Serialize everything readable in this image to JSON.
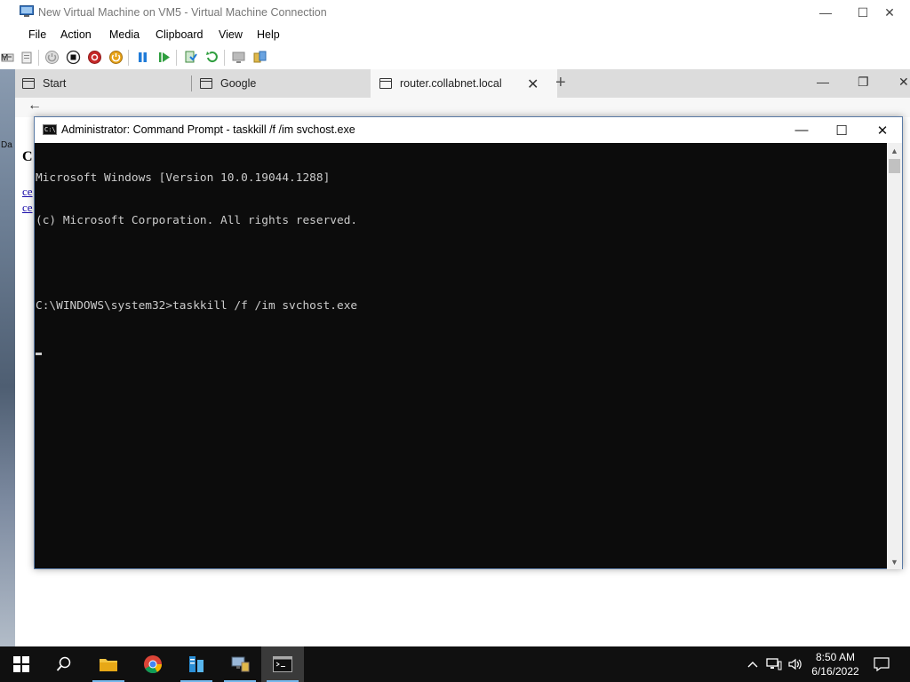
{
  "vm_window": {
    "title": "New Virtual Machine on VM5 - Virtual Machine Connection",
    "controls": {
      "minimize": "—",
      "maximize": "☐",
      "close": "✕"
    },
    "menu": [
      "File",
      "Action",
      "Media",
      "Clipboard",
      "View",
      "Help"
    ],
    "toolbar_icons": [
      "ctrl-alt-del-icon",
      "type-clipboard-icon",
      "start-icon",
      "turn-off-icon",
      "shut-down-icon",
      "save-icon",
      "pause-icon",
      "reset-icon",
      "checkpoint-icon",
      "revert-icon",
      "enhanced-session-icon",
      "share-icon"
    ]
  },
  "guest_desktop": {
    "left_labels": [
      "M",
      "Da"
    ]
  },
  "browser": {
    "tabs": [
      {
        "label": "Start"
      },
      {
        "label": "Google"
      },
      {
        "label": "router.collabnet.local"
      }
    ],
    "controls": {
      "minimize": "—",
      "restore": "❐",
      "close": "✕"
    },
    "page_heading": "C",
    "page_links": [
      "ce",
      "ce"
    ]
  },
  "cmd_window": {
    "title": "Administrator: Command Prompt - taskkill  /f /im svchost.exe",
    "controls": {
      "minimize": "—",
      "maximize": "☐",
      "close": "✕"
    },
    "lines": [
      "Microsoft Windows [Version 10.0.19044.1288]",
      "(c) Microsoft Corporation. All rights reserved.",
      "",
      "C:\\WINDOWS\\system32>taskkill /f /im svchost.exe"
    ]
  },
  "taskbar": {
    "apps": [
      "start-icon",
      "search-icon",
      "file-explorer-icon",
      "chrome-icon",
      "server-manager-icon",
      "network-icon",
      "command-prompt-icon"
    ],
    "clock": {
      "time": "8:50 AM",
      "date": "6/16/2022"
    }
  },
  "colors": {
    "console_bg": "#0c0c0c",
    "console_fg": "#cccccc",
    "taskbar_bg": "#101010",
    "accent": "#76b9ed"
  }
}
